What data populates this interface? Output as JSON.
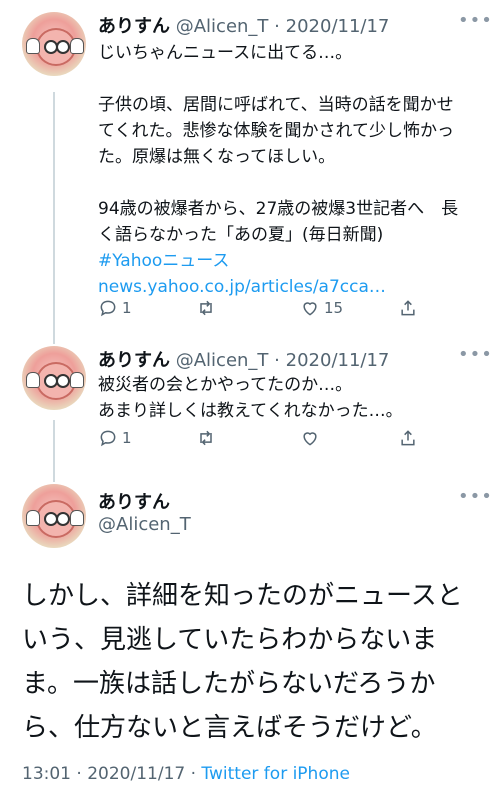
{
  "tweets": [
    {
      "name": "ありすん",
      "handle": "@Alicen_T",
      "sep": "·",
      "date": "2020/11/17",
      "menu": "•••",
      "lines": [
        "じいちゃんニュースに出てる…。",
        "",
        "子供の頃、居間に呼ばれて、当時の話を聞かせ",
        "てくれた。悲惨な体験を聞かされて少し怖かっ",
        "た。原爆は無くなってほしい。",
        "",
        "94歳の被爆者から、27歳の被爆3世記者へ　長",
        "く語らなかった「あの夏」(毎日新聞)"
      ],
      "hashtag": "#Yahooニュース",
      "url": "news.yahoo.co.jp/articles/a7cca…",
      "reply_count": "1",
      "retweet_count": "",
      "like_count": "15"
    },
    {
      "name": "ありすん",
      "handle": "@Alicen_T",
      "sep": "·",
      "date": "2020/11/17",
      "menu": "•••",
      "lines": [
        "被災者の会とかやってたのか…。",
        "あまり詳しくは教えてくれなかった…。"
      ],
      "reply_count": "1",
      "retweet_count": "",
      "like_count": ""
    }
  ],
  "main_tweet": {
    "name": "ありすん",
    "handle": "@Alicen_T",
    "menu": "•••",
    "lines": [
      "しかし、詳細を知ったのがニュースと",
      "いう、見逃していたらわからないま",
      "ま。一族は話したがらないだろうか",
      "ら、仕方ないと言えばそうだけど。"
    ],
    "time": "13:01",
    "sep": "·",
    "date": "2020/11/17",
    "source": "Twitter for iPhone"
  },
  "colors": {
    "link": "#1d9bf0",
    "muted": "#536471",
    "thread_line": "#cfd9de"
  }
}
